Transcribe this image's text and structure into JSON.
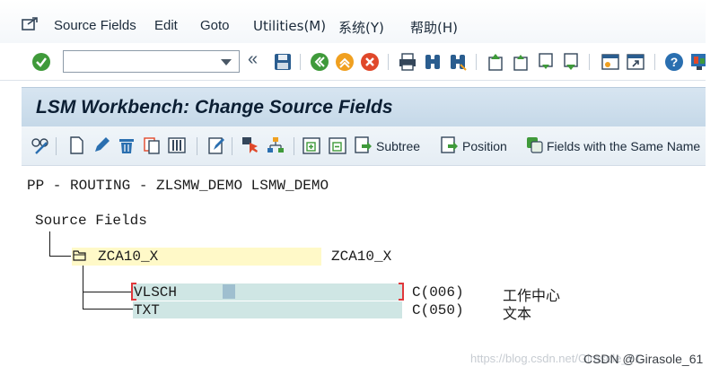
{
  "menubar": {
    "items": [
      {
        "label": "Source Fields",
        "name": "menu-source-fields"
      },
      {
        "label": "Edit",
        "name": "menu-edit"
      },
      {
        "label": "Goto",
        "name": "menu-goto"
      },
      {
        "label": "Utilities(M)",
        "name": "menu-utilities"
      },
      {
        "label": "系统(Y)",
        "name": "menu-system"
      },
      {
        "label": "帮助(H)",
        "name": "menu-help"
      }
    ]
  },
  "toolbar": {
    "command_value": "",
    "icons": [
      "enter-icon",
      "save-icon",
      "back-icon",
      "exit-icon",
      "cancel-icon",
      "print-icon",
      "find-icon",
      "find-next-icon",
      "first-page-icon",
      "previous-page-icon",
      "next-page-icon",
      "last-page-icon",
      "new-session-icon",
      "shortcut-icon",
      "help-icon",
      "customize-layout-icon"
    ]
  },
  "title": "LSM Workbench: Change Source Fields",
  "app_toolbar": {
    "subtree_label": "Subtree",
    "position_label": "Position",
    "same_name_label": "Fields with the Same Name"
  },
  "content": {
    "project_line": "PP - ROUTING - ZLSMW_DEMO LSMW_DEMO",
    "tree_root": "Source Fields",
    "structure": {
      "name": "ZCA10_X",
      "description": "ZCA10_X"
    },
    "fields": [
      {
        "name": "VLSCH",
        "type": "C(006)",
        "description": "工作中心"
      },
      {
        "name": "TXT",
        "type": "C(050)",
        "description": "文本"
      }
    ]
  },
  "watermark": "https://blog.csdn.net/Girasole_61",
  "credit": "CSDN @Girasole_61",
  "colors": {
    "title_bar": "#c9dbea",
    "structure_highlight": "#fff9c8",
    "field_highlight": "#cfe6e4",
    "selection_bracket": "#e0383c"
  }
}
